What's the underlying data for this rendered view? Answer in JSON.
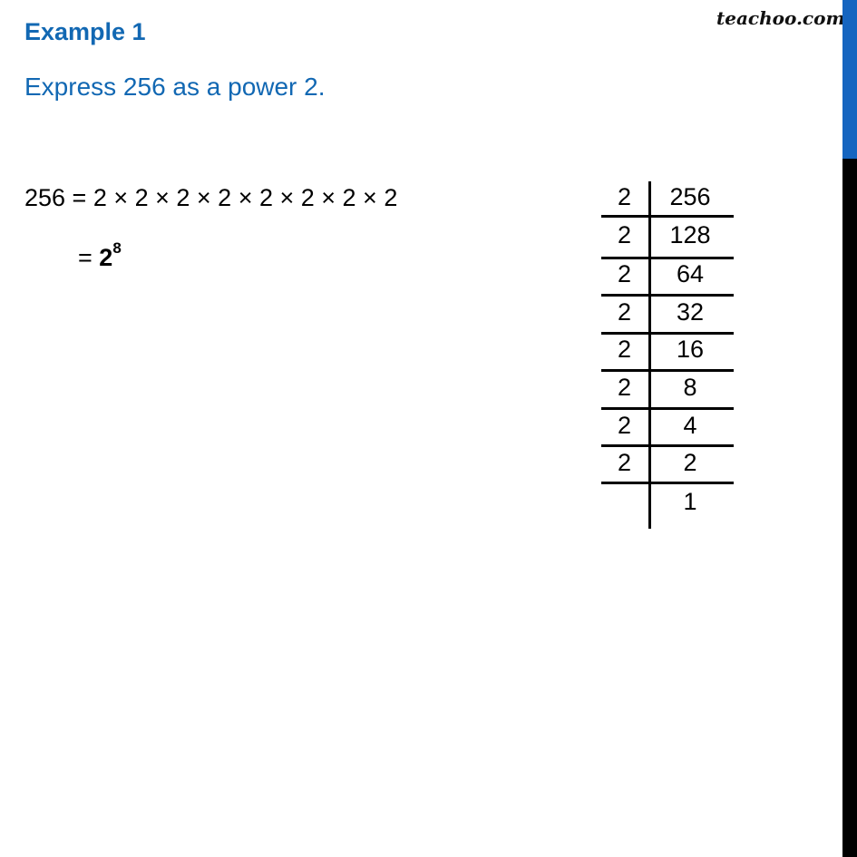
{
  "header": {
    "title": "Example 1",
    "question": "Express 256 as a power 2.",
    "brand": "teachoo.com"
  },
  "solution": {
    "line1": "256 = 2 × 2 × 2 × 2 × 2 × 2 × 2 × 2",
    "line2_prefix": "= ",
    "line2_base": "2",
    "line2_exponent": "8"
  },
  "division_table": {
    "rows": [
      {
        "divisor": "2",
        "quotient": "256"
      },
      {
        "divisor": "2",
        "quotient": "128"
      },
      {
        "divisor": "2",
        "quotient": "64"
      },
      {
        "divisor": "2",
        "quotient": "32"
      },
      {
        "divisor": "2",
        "quotient": "16"
      },
      {
        "divisor": "2",
        "quotient": "8"
      },
      {
        "divisor": "2",
        "quotient": "4"
      },
      {
        "divisor": "2",
        "quotient": "2"
      },
      {
        "divisor": "",
        "quotient": "1"
      }
    ]
  },
  "scrollbar": {
    "progress_fraction": 0.185,
    "progress_color": "#1565c0",
    "track_color": "#000000"
  },
  "colors": {
    "heading": "#1268b3",
    "text": "#000000"
  }
}
